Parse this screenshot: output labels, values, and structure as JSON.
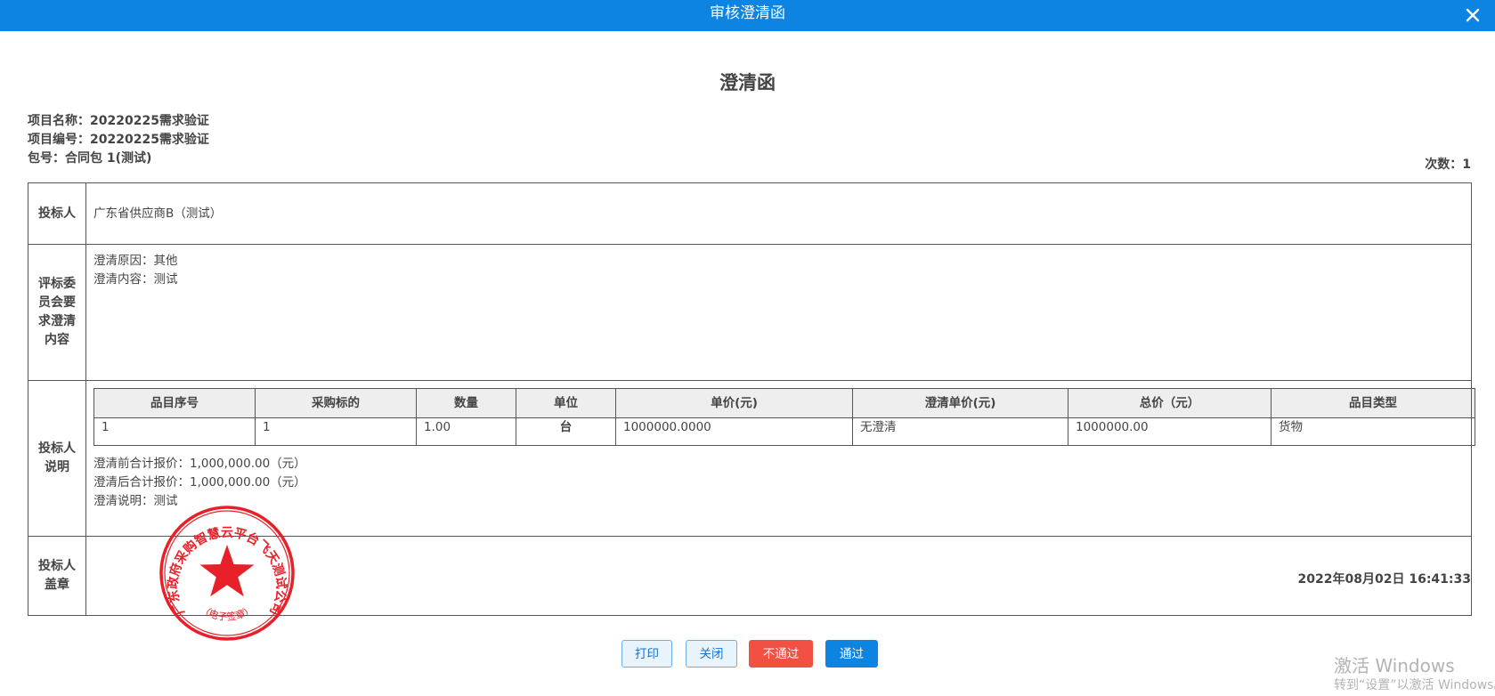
{
  "dialog": {
    "title": "审核澄清函",
    "close_icon": "close-icon",
    "accent_color": "#0d84e2"
  },
  "doc": {
    "title": "澄清函",
    "project_name": "项目名称：20220225需求验证",
    "project_number": "项目编号：20220225需求验证",
    "package": "包号：合同包 1(测试)",
    "count": "次数：1",
    "timestamp": "2022年08月02日 16:41:33"
  },
  "rows": {
    "bidder": {
      "label": "投标人",
      "value": "广东省供应商B（测试）"
    },
    "committee": {
      "label": "评标委员会要求澄清内容",
      "reason": "澄清原因：其他",
      "content": "澄清内容：测试"
    },
    "explain": {
      "label": "投标人说明",
      "columns": [
        "品目序号",
        "采购标的",
        "数量",
        "单位",
        "单价(元)",
        "澄清单价(元)",
        "总价（元）",
        "品目类型"
      ],
      "items": [
        {
          "seq": "1",
          "subject": "1",
          "qty": "1.00",
          "unit": "台",
          "price": "1000000.0000",
          "clarified_price": "无澄清",
          "total": "1000000.00",
          "type": "货物"
        }
      ],
      "before_total": "澄清前合计报价：1,000,000.00（元）",
      "after_total": "澄清后合计报价：1,000,000.00（元）",
      "note": "澄清说明：测试"
    },
    "seal": {
      "label": "投标人盖章"
    }
  },
  "seal_stamp": {
    "text": "广东政府采购智慧云平台飞天测试公司",
    "sub_text": "（电子签章）",
    "color": "#e8202a"
  },
  "buttons": {
    "print": "打印",
    "close": "关闭",
    "reject": "不通过",
    "approve": "通过"
  },
  "watermark": {
    "line1": "激活 Windows",
    "line2": "转到“设置”以激活 Windows。"
  }
}
